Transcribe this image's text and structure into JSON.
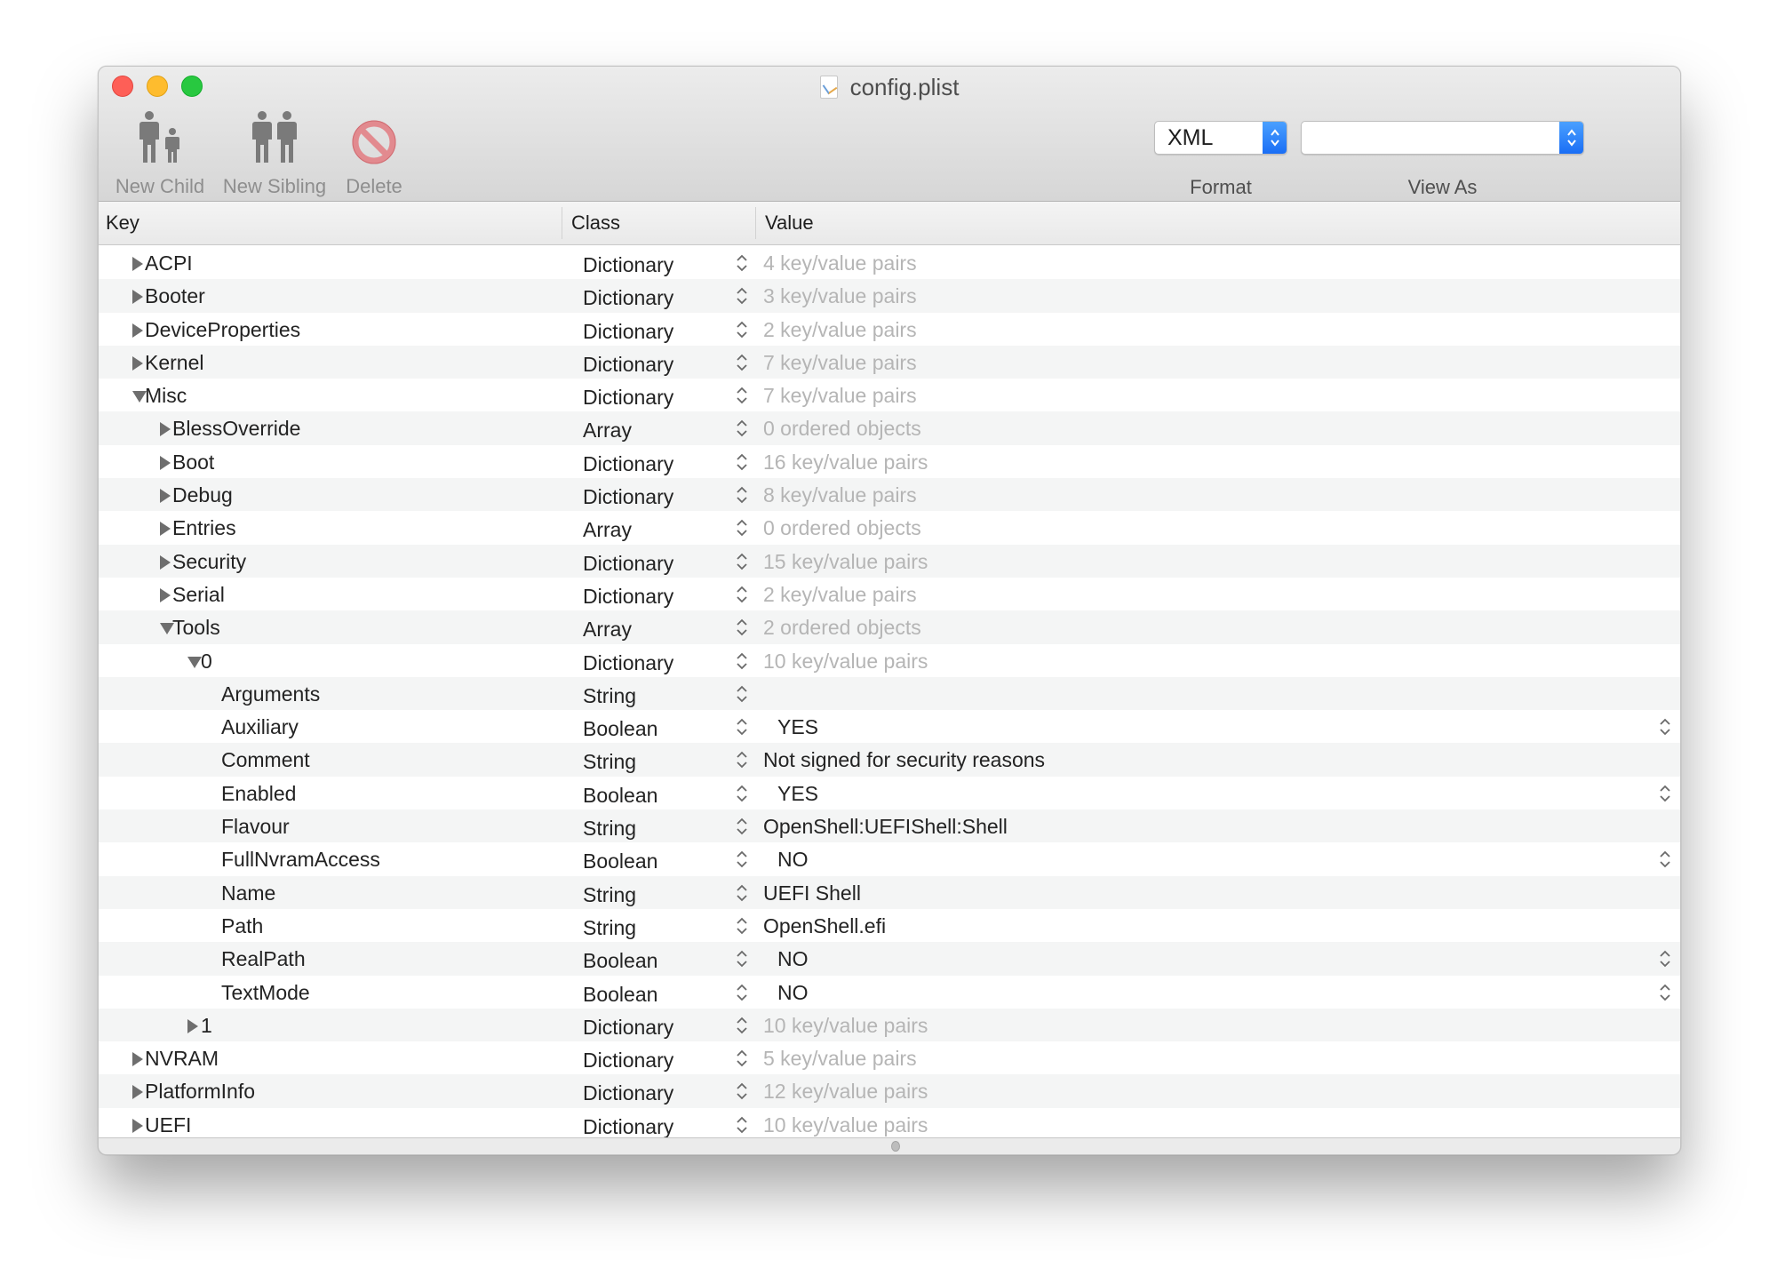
{
  "window": {
    "title": "config.plist",
    "title_icon": "plist-document-icon"
  },
  "toolbar": {
    "new_child": {
      "label": "New Child",
      "icon": "new-child-icon"
    },
    "new_sibling": {
      "label": "New Sibling",
      "icon": "new-sibling-icon"
    },
    "delete": {
      "label": "Delete",
      "icon": "delete-icon"
    },
    "format": {
      "label": "Format",
      "value": "XML"
    },
    "view_as": {
      "label": "View As",
      "value": ""
    }
  },
  "colors": {
    "accent": "#1a6ef5",
    "muted_text": "#b5b5b5",
    "row_alt": "#f4f5f5",
    "close": "#fe5f57",
    "minimize": "#febc2e",
    "maximize": "#28c840"
  },
  "table": {
    "columns": [
      "Key",
      "Class",
      "Value"
    ],
    "rows": [
      {
        "key": "ACPI",
        "level": 0,
        "disclosure": "collapsed",
        "class": "Dictionary",
        "value": "4 key/value pairs",
        "muted": true
      },
      {
        "key": "Booter",
        "level": 0,
        "disclosure": "collapsed",
        "class": "Dictionary",
        "value": "3 key/value pairs",
        "muted": true
      },
      {
        "key": "DeviceProperties",
        "level": 0,
        "disclosure": "collapsed",
        "class": "Dictionary",
        "value": "2 key/value pairs",
        "muted": true
      },
      {
        "key": "Kernel",
        "level": 0,
        "disclosure": "collapsed",
        "class": "Dictionary",
        "value": "7 key/value pairs",
        "muted": true
      },
      {
        "key": "Misc",
        "level": 0,
        "disclosure": "expanded",
        "class": "Dictionary",
        "value": "7 key/value pairs",
        "muted": true
      },
      {
        "key": "BlessOverride",
        "level": 1,
        "disclosure": "collapsed",
        "class": "Array",
        "value": "0 ordered objects",
        "muted": true
      },
      {
        "key": "Boot",
        "level": 1,
        "disclosure": "collapsed",
        "class": "Dictionary",
        "value": "16 key/value pairs",
        "muted": true
      },
      {
        "key": "Debug",
        "level": 1,
        "disclosure": "collapsed",
        "class": "Dictionary",
        "value": "8 key/value pairs",
        "muted": true
      },
      {
        "key": "Entries",
        "level": 1,
        "disclosure": "collapsed",
        "class": "Array",
        "value": "0 ordered objects",
        "muted": true
      },
      {
        "key": "Security",
        "level": 1,
        "disclosure": "collapsed",
        "class": "Dictionary",
        "value": "15 key/value pairs",
        "muted": true
      },
      {
        "key": "Serial",
        "level": 1,
        "disclosure": "collapsed",
        "class": "Dictionary",
        "value": "2 key/value pairs",
        "muted": true
      },
      {
        "key": "Tools",
        "level": 1,
        "disclosure": "expanded",
        "class": "Array",
        "value": "2 ordered objects",
        "muted": true
      },
      {
        "key": "0",
        "level": 2,
        "disclosure": "expanded",
        "class": "Dictionary",
        "value": "10 key/value pairs",
        "muted": true
      },
      {
        "key": "Arguments",
        "level": 3,
        "disclosure": "none",
        "class": "String",
        "value": "",
        "muted": false
      },
      {
        "key": "Auxiliary",
        "level": 3,
        "disclosure": "none",
        "class": "Boolean",
        "value": "YES",
        "muted": false,
        "boolean": true
      },
      {
        "key": "Comment",
        "level": 3,
        "disclosure": "none",
        "class": "String",
        "value": "Not signed for security reasons",
        "muted": false
      },
      {
        "key": "Enabled",
        "level": 3,
        "disclosure": "none",
        "class": "Boolean",
        "value": "YES",
        "muted": false,
        "boolean": true
      },
      {
        "key": "Flavour",
        "level": 3,
        "disclosure": "none",
        "class": "String",
        "value": "OpenShell:UEFIShell:Shell",
        "muted": false
      },
      {
        "key": "FullNvramAccess",
        "level": 3,
        "disclosure": "none",
        "class": "Boolean",
        "value": "NO",
        "muted": false,
        "boolean": true
      },
      {
        "key": "Name",
        "level": 3,
        "disclosure": "none",
        "class": "String",
        "value": "UEFI Shell",
        "muted": false
      },
      {
        "key": "Path",
        "level": 3,
        "disclosure": "none",
        "class": "String",
        "value": "OpenShell.efi",
        "muted": false
      },
      {
        "key": "RealPath",
        "level": 3,
        "disclosure": "none",
        "class": "Boolean",
        "value": "NO",
        "muted": false,
        "boolean": true
      },
      {
        "key": "TextMode",
        "level": 3,
        "disclosure": "none",
        "class": "Boolean",
        "value": "NO",
        "muted": false,
        "boolean": true
      },
      {
        "key": "1",
        "level": 2,
        "disclosure": "collapsed",
        "class": "Dictionary",
        "value": "10 key/value pairs",
        "muted": true
      },
      {
        "key": "NVRAM",
        "level": 0,
        "disclosure": "collapsed",
        "class": "Dictionary",
        "value": "5 key/value pairs",
        "muted": true
      },
      {
        "key": "PlatformInfo",
        "level": 0,
        "disclosure": "collapsed",
        "class": "Dictionary",
        "value": "12 key/value pairs",
        "muted": true
      },
      {
        "key": "UEFI",
        "level": 0,
        "disclosure": "collapsed",
        "class": "Dictionary",
        "value": "10 key/value pairs",
        "muted": true
      }
    ]
  }
}
